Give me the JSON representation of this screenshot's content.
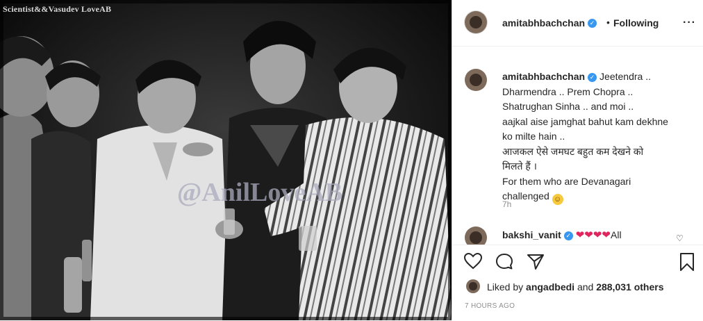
{
  "photo": {
    "watermark_top": "Scientist&&Vasudev LoveAB",
    "watermark_center": "@AnilLoveAB"
  },
  "header": {
    "username": "amitabhbachchan",
    "separator": "•",
    "follow_status": "Following",
    "more_icon": "more-icon"
  },
  "caption": {
    "username": "amitabhbachchan",
    "lines": [
      "Jeetendra ..",
      "Dharmendra .. Prem Chopra ..",
      "Shatrughan Sinha .. and moi ..",
      "aajkal aise jamghat bahut kam dekhne",
      "ko milte hain ..",
      "आजकल ऐसे जमघट बहुत कम देखने को",
      "मिलते हैं ।",
      "For them who are Devanagari",
      "challenged"
    ],
    "emoji": "laughing-emoji",
    "time_ago": "7h"
  },
  "comment": {
    "username": "bakshi_vanit",
    "hearts": "❤❤❤❤",
    "text": "All"
  },
  "actions": {
    "liked_by_prefix": "Liked by",
    "liked_user": "angadbedi",
    "and": "and",
    "others_count": "288,031 others",
    "date": "7 HOURS AGO"
  },
  "colors": {
    "verified": "#3897f0",
    "heart": "#e0245e",
    "muted": "#8e8e8e"
  }
}
